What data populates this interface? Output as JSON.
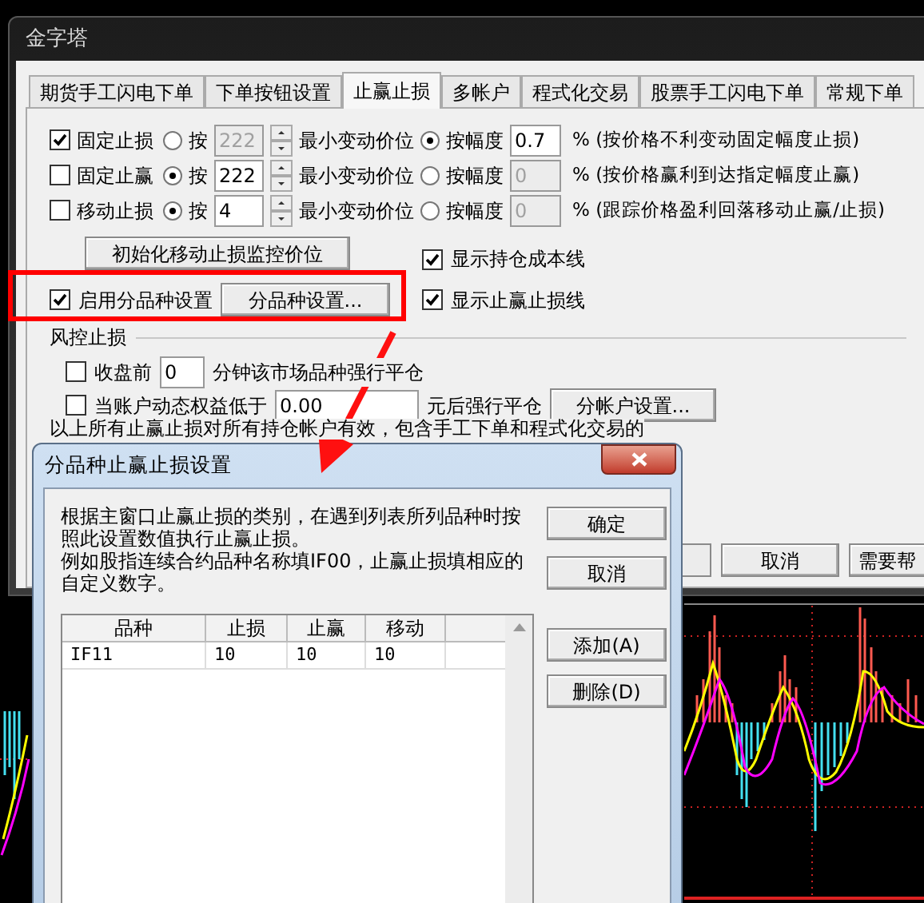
{
  "main_window": {
    "title": "金字塔",
    "tabs": [
      {
        "label": "期货手工闪电下单",
        "selected": false
      },
      {
        "label": "下单按钮设置",
        "selected": false
      },
      {
        "label": "止赢止损",
        "selected": true
      },
      {
        "label": "多帐户",
        "selected": false
      },
      {
        "label": "程式化交易",
        "selected": false
      },
      {
        "label": "股票手工闪电下单",
        "selected": false
      },
      {
        "label": "常规下单",
        "selected": false
      }
    ],
    "stop_rows": [
      {
        "label": "固定止损",
        "checked": true,
        "by_ticks": {
          "label": "按",
          "selected": false,
          "value": "222"
        },
        "tick_unit": "最小变动价位",
        "by_percent": {
          "label": "按幅度",
          "selected": true,
          "value": "0.7"
        },
        "note": "% (按价格不利变动固定幅度止损)"
      },
      {
        "label": "固定止赢",
        "checked": false,
        "by_ticks": {
          "label": "按",
          "selected": true,
          "value": "222"
        },
        "tick_unit": "最小变动价位",
        "by_percent": {
          "label": "按幅度",
          "selected": false,
          "value": "0"
        },
        "note": "% (按价格赢利到达指定幅度止赢)"
      },
      {
        "label": "移动止损",
        "checked": false,
        "by_ticks": {
          "label": "按",
          "selected": true,
          "value": "4"
        },
        "tick_unit": "最小变动价位",
        "by_percent": {
          "label": "按幅度",
          "selected": false,
          "value": "0"
        },
        "note": "% (跟踪价格盈利回落移动止赢/止损)"
      }
    ],
    "init_button": "初始化移动止损监控价位",
    "show_cost_line": {
      "label": "显示持仓成本线",
      "checked": true
    },
    "per_symbol": {
      "label": "启用分品种设置",
      "checked": true,
      "button": "分品种设置..."
    },
    "show_stop_lines": {
      "label": "显示止赢止损线",
      "checked": true
    },
    "risk": {
      "title": "风控止损",
      "close_before": {
        "label": "收盘前",
        "checked": false,
        "value": "0",
        "suffix": "分钟该市场品种强行平仓"
      },
      "equity": {
        "label": "当账户动态权益低于",
        "checked": false,
        "value": "0.00",
        "suffix": "元后强行平仓",
        "button": "分帐户设置..."
      }
    },
    "footnote": "以上所有止赢止损对所有持仓帐户有效，包含手工下单和程式化交易的",
    "buttons": [
      "取消",
      "需要帮"
    ]
  },
  "dialog": {
    "title": "分品种止赢止损设置",
    "paragraphs": [
      "根据主窗口止赢止损的类别，在遇到列表所列品种时按照此设置数值执行止赢止损。",
      "例如股指连续合约品种名称填IF00，止赢止损填相应的自定义数字。"
    ],
    "buttons": [
      "确定",
      "取消",
      "添加(A)",
      "删除(D)"
    ],
    "table": {
      "columns": [
        "品种",
        "止损",
        "止赢",
        "移动"
      ],
      "rows": [
        [
          "IF11",
          "10",
          "10",
          "10"
        ]
      ]
    }
  }
}
